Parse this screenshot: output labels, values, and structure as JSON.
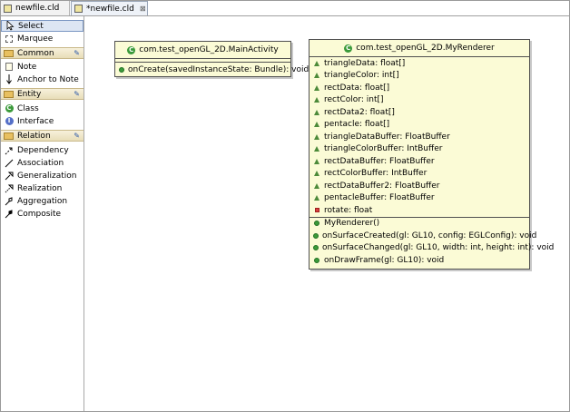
{
  "tabs": [
    {
      "label": "newfile.cld",
      "active": false
    },
    {
      "label": "*newfile.cld",
      "active": true,
      "close": "⊠"
    }
  ],
  "palette": {
    "tools": [
      {
        "label": "Select",
        "icon": "arrow-cursor-icon"
      },
      {
        "label": "Marquee",
        "icon": "marquee-icon"
      }
    ],
    "drawers": {
      "common": {
        "label": "Common",
        "items": [
          {
            "label": "Note",
            "icon": "note-icon"
          },
          {
            "label": "Anchor to Note",
            "icon": "anchor-arrow-icon"
          }
        ]
      },
      "entity": {
        "label": "Entity",
        "items": [
          {
            "label": "Class",
            "icon": "class-icon",
            "glyph": "C"
          },
          {
            "label": "Interface",
            "icon": "interface-icon",
            "glyph": "I"
          }
        ]
      },
      "relation": {
        "label": "Relation",
        "items": [
          {
            "label": "Dependency",
            "icon": "dependency-icon"
          },
          {
            "label": "Association",
            "icon": "association-icon"
          },
          {
            "label": "Generalization",
            "icon": "generalization-icon"
          },
          {
            "label": "Realization",
            "icon": "realization-icon"
          },
          {
            "label": "Aggregation",
            "icon": "aggregation-icon"
          },
          {
            "label": "Composite",
            "icon": "composite-icon"
          }
        ]
      }
    }
  },
  "diagram": {
    "main_activity": {
      "title": "com.test_openGL_2D.MainActivity",
      "methods": [
        {
          "text": "onCreate(savedInstanceState: Bundle): void",
          "visibility": "public"
        }
      ]
    },
    "my_renderer": {
      "title": "com.test_openGL_2D.MyRenderer",
      "fields": [
        {
          "text": "triangleData: float[]",
          "visibility": "package"
        },
        {
          "text": "triangleColor: int[]",
          "visibility": "package"
        },
        {
          "text": "rectData: float[]",
          "visibility": "package"
        },
        {
          "text": "rectColor: int[]",
          "visibility": "package"
        },
        {
          "text": "rectData2: float[]",
          "visibility": "package"
        },
        {
          "text": "pentacle: float[]",
          "visibility": "package"
        },
        {
          "text": "triangleDataBuffer: FloatBuffer",
          "visibility": "package"
        },
        {
          "text": "triangleColorBuffer: IntBuffer",
          "visibility": "package"
        },
        {
          "text": "rectDataBuffer: FloatBuffer",
          "visibility": "package"
        },
        {
          "text": "rectColorBuffer: IntBuffer",
          "visibility": "package"
        },
        {
          "text": "rectDataBuffer2: FloatBuffer",
          "visibility": "package"
        },
        {
          "text": "pentacleBuffer: FloatBuffer",
          "visibility": "package"
        },
        {
          "text": "rotate: float",
          "visibility": "private"
        }
      ],
      "methods": [
        {
          "text": "MyRenderer()",
          "visibility": "public"
        },
        {
          "text": "onSurfaceCreated(gl: GL10, config: EGLConfig): void",
          "visibility": "public"
        },
        {
          "text": "onSurfaceChanged(gl: GL10, width: int, height: int): void",
          "visibility": "public"
        },
        {
          "text": "onDrawFrame(gl: GL10): void",
          "visibility": "public"
        }
      ]
    }
  },
  "colors": {
    "class_fill": "#fbfbd6",
    "class_border": "#505050",
    "drawer_fill": "#e8ddb8"
  }
}
